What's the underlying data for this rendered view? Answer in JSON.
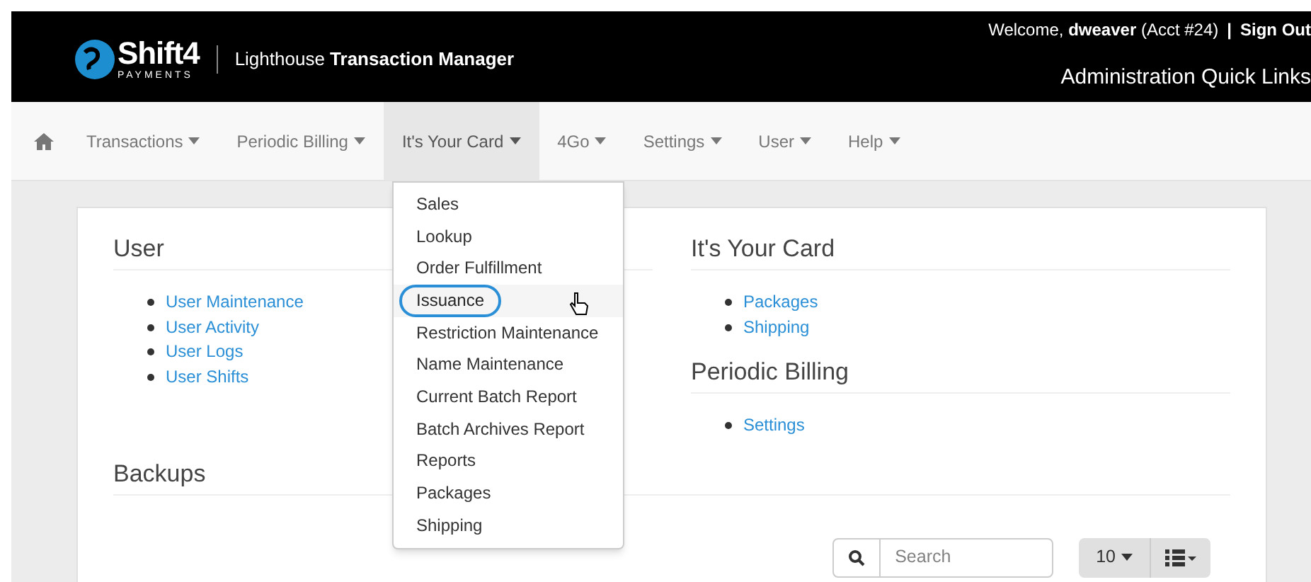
{
  "header": {
    "logo": {
      "name": "Shift4",
      "tagline": "PAYMENTS"
    },
    "app_title": "Lighthouse **Transaction Manager**",
    "welcome": "Welcome, **dweaver** (Acct #24)",
    "separator": "|",
    "sign_out": "Sign Out",
    "quick_links": "Administration Quick Links"
  },
  "nav": {
    "items": [
      {
        "label": "Transactions",
        "selected": false
      },
      {
        "label": "Periodic Billing",
        "selected": false
      },
      {
        "label": "It's Your Card",
        "selected": true
      },
      {
        "label": "4Go",
        "selected": false
      },
      {
        "label": "Settings",
        "selected": false
      },
      {
        "label": "User",
        "selected": false
      },
      {
        "label": "Help",
        "selected": false
      }
    ]
  },
  "dropdown": {
    "items": [
      {
        "label": "Sales",
        "selected": false
      },
      {
        "label": "Lookup",
        "selected": false
      },
      {
        "label": "Order Fulfillment",
        "selected": false
      },
      {
        "label": "Issuance",
        "selected": true
      },
      {
        "label": "Restriction Maintenance",
        "selected": false
      },
      {
        "label": "Name Maintenance",
        "selected": false
      },
      {
        "label": "Current Batch Report",
        "selected": false
      },
      {
        "label": "Batch Archives Report",
        "selected": false
      },
      {
        "label": "Reports",
        "selected": false
      },
      {
        "label": "Packages",
        "selected": false
      },
      {
        "label": "Shipping",
        "selected": false
      }
    ]
  },
  "sections_left": [
    {
      "title": "User",
      "links": [
        "User Maintenance",
        "User Activity",
        "User Logs",
        "User Shifts"
      ]
    }
  ],
  "sections_right": [
    {
      "title": "It's Your Card",
      "links": [
        "Packages",
        "Shipping"
      ]
    },
    {
      "title": "Periodic Billing",
      "links": [
        "Settings"
      ]
    }
  ],
  "backups": {
    "title": "Backups",
    "search": {
      "placeholder": "Search"
    },
    "page_size": "10"
  }
}
